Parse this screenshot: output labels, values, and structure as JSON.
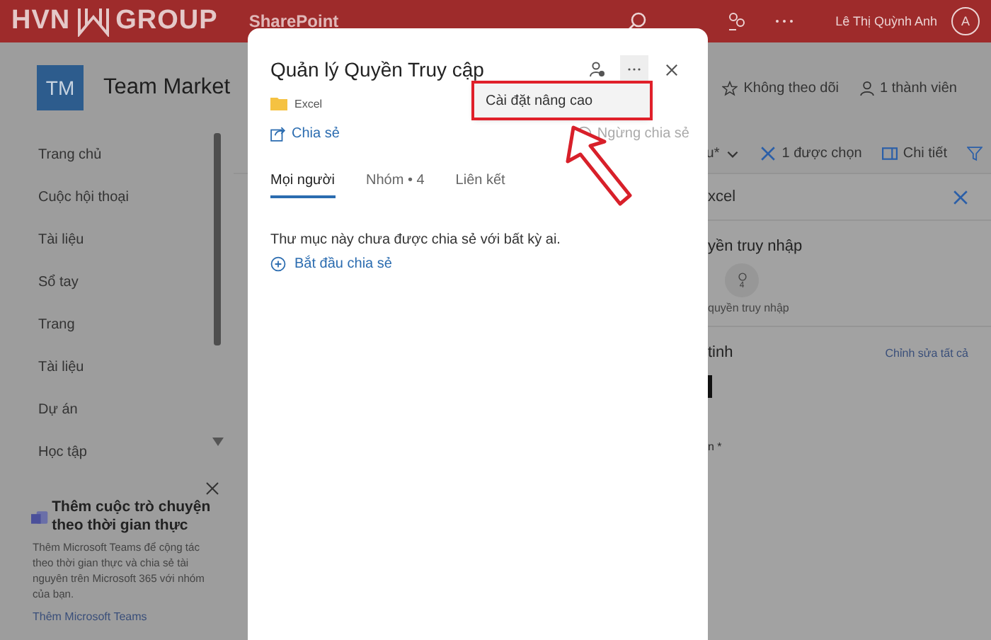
{
  "top_bar": {
    "logo_left": "HVN",
    "logo_right": "GROUP",
    "app_name": "SharePoint",
    "user_name": "Lê Thị Quỳnh Anh",
    "avatar_initial": "A"
  },
  "site": {
    "logo_initials": "TM",
    "title": "Team Market",
    "follow": "Không theo dõi",
    "members": "1 thành viên"
  },
  "sidebar": {
    "items": [
      {
        "label": "Trang chủ"
      },
      {
        "label": "Cuộc hội thoại"
      },
      {
        "label": "Tài liệu"
      },
      {
        "label": "Sổ tay"
      },
      {
        "label": "Trang"
      },
      {
        "label": "Tài liệu"
      },
      {
        "label": "Dự án"
      },
      {
        "label": "Học tập"
      }
    ],
    "promo": {
      "title": "Thêm cuộc trò chuyện theo thời gian thực",
      "body": "Thêm Microsoft Teams để cộng tác theo thời gian thực và chia sẻ tài nguyên trên Microsoft 365 với nhóm của bạn.",
      "link": "Thêm Microsoft Teams"
    }
  },
  "toolbar": {
    "view": "u*",
    "selection": "1 được chọn",
    "details": "Chi tiết"
  },
  "details_panel": {
    "title": "xcel",
    "access_heading": "yền truy nhập",
    "access_count": "4",
    "access_caption": "quyền truy nhập",
    "properties_heading": "tinh",
    "edit_all": "Chỉnh sửa tất cả",
    "field_label": "n *"
  },
  "dialog": {
    "title": "Quản lý Quyền Truy cập",
    "item": "Excel",
    "share": "Chia sẻ",
    "stop_sharing": "Ngừng chia sẻ",
    "stop_sharing_disabled": true,
    "menu": [
      {
        "label": "Cài đặt nâng cao",
        "highlighted": true
      }
    ],
    "tabs": [
      {
        "label": "Mọi người",
        "selected": true
      },
      {
        "label": "Nhóm • 4",
        "selected": false
      },
      {
        "label": "Liên kết",
        "selected": false
      }
    ],
    "empty_message": "Thư mục này chưa được chia sẻ với bất kỳ ai.",
    "start_sharing": "Bắt đầu chia sẻ"
  }
}
